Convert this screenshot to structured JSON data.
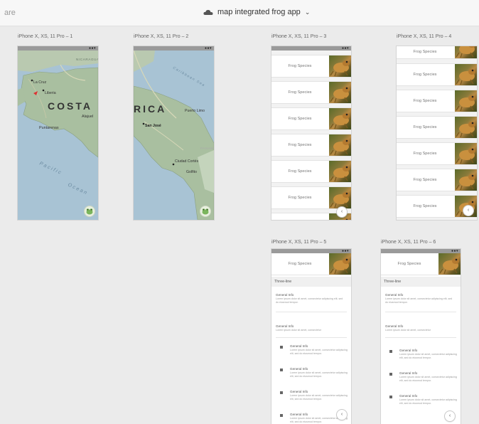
{
  "topbar": {
    "share_label": "are",
    "doc_title": "map integrated frog app",
    "cloud_icon": "cloud-icon",
    "chevron": "⌄"
  },
  "artboards": [
    {
      "id": "a1",
      "label": "iPhone X, XS, 11 Pro – 1"
    },
    {
      "id": "a2",
      "label": "iPhone X, XS, 11 Pro – 2"
    },
    {
      "id": "a3",
      "label": "iPhone X, XS, 11 Pro – 3"
    },
    {
      "id": "a4",
      "label": "iPhone X, XS, 11 Pro – 4"
    },
    {
      "id": "a5",
      "label": "iPhone X, XS, 11 Pro – 5"
    },
    {
      "id": "a6",
      "label": "iPhone X, XS, 11 Pro – 6"
    }
  ],
  "status_dots": "●●▾",
  "map1": {
    "labels": [
      "NICARAGUA",
      "La Cruz",
      "Liberia",
      "COSTA",
      "Alajuel",
      "Puntarenas",
      "Pacific",
      "Ocean"
    ]
  },
  "map2": {
    "labels": [
      "Caribbean Sea",
      "RICA",
      "Puerto Limo",
      "San José",
      "PANAM",
      "Ciudad Cortés",
      "Golfito"
    ]
  },
  "species_label": "Frog Species",
  "detail": {
    "header": "Frog Species",
    "section": "Three-line",
    "item_title": "General Info",
    "body_long": "Lorem ipsum dolor sit amet, consectetur adipiscing elit, sed do eiusmod tempor.",
    "body_short": "Lorem ipsum dolor sit amet, consectetur"
  },
  "back_icon": "‹",
  "colors": {
    "statusbar": "#9a9a9a",
    "map_water": "#a8c3d4",
    "map_land": "#a9bfa0"
  }
}
